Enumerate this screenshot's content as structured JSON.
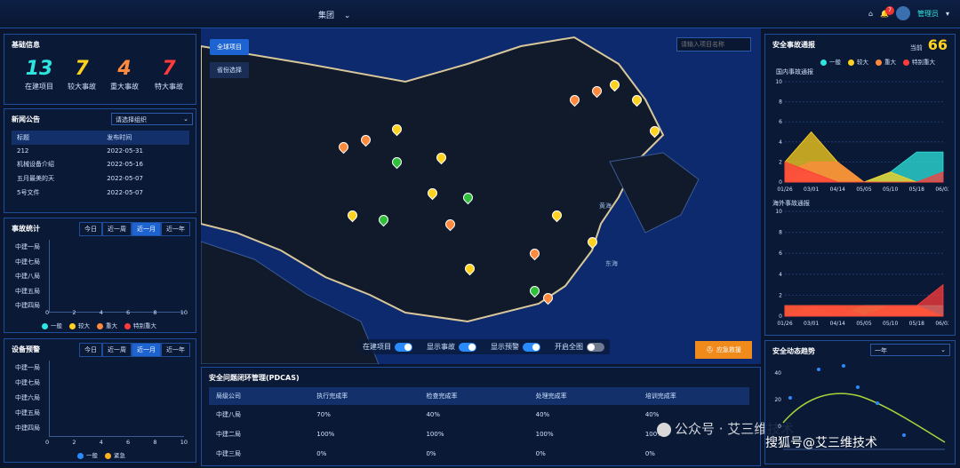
{
  "topbar": {
    "group": "集团",
    "notif_count": "7",
    "user": "管理员"
  },
  "basic": {
    "title": "基础信息",
    "kpis": [
      {
        "value": "13",
        "label": "在建项目",
        "color": "#2ee6e0"
      },
      {
        "value": "7",
        "label": "较大事故",
        "color": "#ffd21f"
      },
      {
        "value": "4",
        "label": "重大事故",
        "color": "#ff8a3d"
      },
      {
        "value": "7",
        "label": "特大事故",
        "color": "#ff3b3b"
      }
    ]
  },
  "news": {
    "title": "新闻公告",
    "select_placeholder": "请选择组织",
    "head": [
      "标题",
      "发布时间"
    ],
    "rows": [
      [
        "212",
        "2022-05-31"
      ],
      [
        "机械设备介绍",
        "2022-05-16"
      ],
      [
        "五月最美的天",
        "2022-05-07"
      ],
      [
        "5号文件",
        "2022-05-07"
      ]
    ]
  },
  "accident_stats": {
    "title": "事故统计",
    "tabs": [
      "今日",
      "近一周",
      "近一月",
      "近一年"
    ],
    "active_tab": 2,
    "rows": [
      "中建一局",
      "中建七局",
      "中建八局",
      "中建五局",
      "中建四局"
    ],
    "xticks": [
      "0",
      "2",
      "4",
      "6",
      "8",
      "10"
    ],
    "legend": [
      "一般",
      "较大",
      "重大",
      "特别重大"
    ]
  },
  "equipment": {
    "title": "设备预警",
    "tabs": [
      "今日",
      "近一周",
      "近一月",
      "近一年"
    ],
    "active_tab": 2,
    "rows": [
      "中建一局",
      "中建七局",
      "中建六局",
      "中建五局",
      "中建四局"
    ],
    "xticks": [
      "0",
      "2",
      "4",
      "6",
      "8",
      "10"
    ],
    "legend": [
      "一般",
      "紧急"
    ]
  },
  "map": {
    "btn_all": "全球项目",
    "btn_province": "省份选择",
    "search_placeholder": "请输入项目名称",
    "sea_labels": [
      "黄海",
      "东海"
    ],
    "toggles": [
      {
        "label": "在建项目",
        "on": true
      },
      {
        "label": "显示事故",
        "on": true
      },
      {
        "label": "显示预警",
        "on": true
      },
      {
        "label": "开启全图",
        "on": false
      }
    ],
    "emergency_btn": "应急救援"
  },
  "pdcas": {
    "title": "安全问题闭环管理(PDCAS)",
    "head": [
      "局级公司",
      "执行完成率",
      "检查完成率",
      "处理完成率",
      "培训完成率"
    ],
    "rows": [
      [
        "中建八局",
        "70%",
        "40%",
        "40%",
        "40%"
      ],
      [
        "中建二局",
        "100%",
        "100%",
        "100%",
        "100%"
      ],
      [
        "中建三局",
        "0%",
        "0%",
        "0%",
        "0%"
      ]
    ]
  },
  "safety_report": {
    "title": "安全事故通报",
    "today_label": "当前",
    "today_value": "66",
    "legend": [
      "一般",
      "较大",
      "重大",
      "特别重大"
    ],
    "domestic_title": "国内事故通报",
    "overseas_title": "海外事故通报",
    "yticks": [
      "0",
      "2",
      "4",
      "6",
      "8",
      "10"
    ],
    "xticks": [
      "01/26",
      "03/01",
      "04/14",
      "05/05",
      "05/10",
      "05/18",
      "06/02"
    ]
  },
  "trend": {
    "title": "安全动态趋势",
    "select": "一年",
    "yticks": [
      "0",
      "20",
      "40"
    ]
  },
  "watermark": {
    "a": "公众号 · 艾三维技术",
    "b": "搜狐号@艾三维技术"
  },
  "chart_data": [
    {
      "type": "area",
      "title": "国内事故通报",
      "categories": [
        "01/26",
        "03/01",
        "04/14",
        "05/05",
        "05/10",
        "05/18",
        "06/02"
      ],
      "ylim": [
        0,
        10
      ],
      "series": [
        {
          "name": "一般",
          "values": [
            0,
            1,
            0,
            0,
            1,
            3,
            3
          ]
        },
        {
          "name": "较大",
          "values": [
            2,
            5,
            2,
            0,
            1,
            0,
            0
          ]
        },
        {
          "name": "重大",
          "values": [
            1,
            2,
            2,
            0,
            0,
            0,
            0
          ]
        },
        {
          "name": "特别重大",
          "values": [
            2,
            1,
            0,
            0,
            0,
            0,
            1
          ]
        }
      ]
    },
    {
      "type": "area",
      "title": "海外事故通报",
      "categories": [
        "01/26",
        "03/01",
        "04/14",
        "05/05",
        "05/10",
        "05/18",
        "06/02"
      ],
      "ylim": [
        0,
        10
      ],
      "series": [
        {
          "name": "一般",
          "values": [
            0,
            1,
            0,
            1,
            1,
            1,
            1
          ]
        },
        {
          "name": "较大",
          "values": [
            1,
            1,
            1,
            1,
            1,
            1,
            0
          ]
        },
        {
          "name": "重大",
          "values": [
            0,
            1,
            1,
            0,
            1,
            1,
            0
          ]
        },
        {
          "name": "特别重大",
          "values": [
            1,
            1,
            1,
            1,
            1,
            1,
            3
          ]
        }
      ]
    }
  ]
}
